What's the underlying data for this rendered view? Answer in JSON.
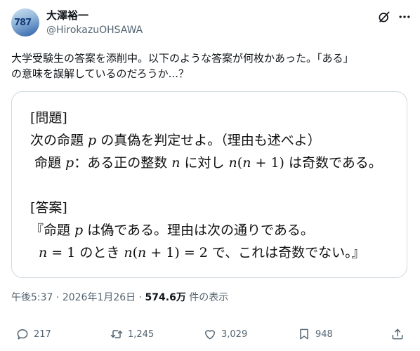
{
  "author": {
    "display_name": "大澤裕一",
    "handle": "@HirokazuOHSAWA",
    "avatar_text": "787"
  },
  "tweet": {
    "text_lines": [
      "大学受験生の答案を添削中。以下のような答案が何枚かあった。「ある」",
      "の意味を誤解しているのだろうか...？"
    ]
  },
  "image_card": {
    "problem_heading": "[問題]",
    "problem_line1": "次の命題 𝑝 の真偽を判定せよ。（理由も述べよ）",
    "problem_line2": "命題 𝑝：ある正の整数 𝑛 に対し 𝑛(𝑛 + 1) は奇数である。",
    "answer_heading": "[答案]",
    "answer_line1": "『命題 𝑝 は偽である。理由は次の通りである。",
    "answer_line2": "𝑛 = 1 のとき 𝑛(𝑛 + 1) = 2 で、これは奇数でない。』"
  },
  "meta": {
    "time": "午後5:37",
    "sep1": " · ",
    "date": "2026年1月26日",
    "sep2": " · ",
    "views": "574.6万",
    "views_label": " 件の表示"
  },
  "actions": {
    "replies": "217",
    "reposts": "1,245",
    "likes": "3,029",
    "bookmarks": "948"
  },
  "colors": {
    "text": "#0f1419",
    "secondary": "#536471",
    "border": "#cfd9de"
  }
}
